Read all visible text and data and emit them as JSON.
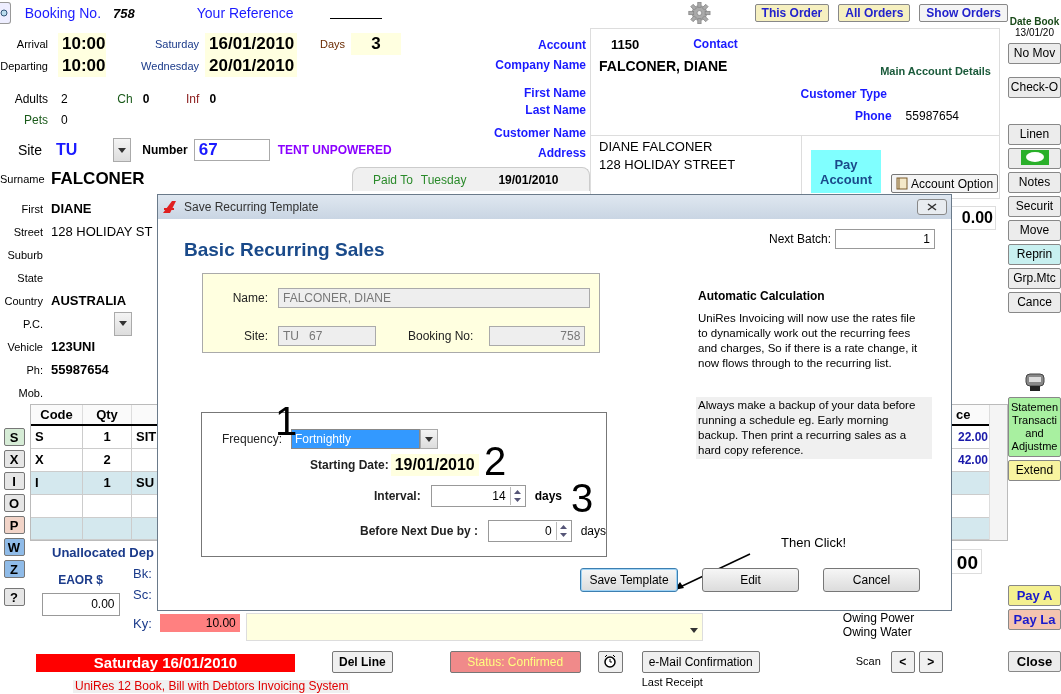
{
  "top_bar": {
    "booking_no_label": "Booking No.",
    "booking_no": "758",
    "reference_label": "Your Reference",
    "buttons": [
      "This Order",
      "All Orders",
      "Show Orders"
    ]
  },
  "stay": {
    "arrival_label": "Arrival",
    "arrival": "10:00",
    "departing_label": "Departing",
    "departing": "10:00",
    "arrival_day": "Saturday",
    "arrival_date": "16/01/2010",
    "departing_day": "Wednesday",
    "departing_date": "20/01/2010",
    "days_label": "Days",
    "days": "3"
  },
  "guests": [
    {
      "label": "Adults",
      "value": "2"
    },
    {
      "label": "Ch",
      "value": "0"
    },
    {
      "label": "Inf",
      "value": "0"
    },
    {
      "label": "Pets",
      "value": "0"
    }
  ],
  "site": {
    "label": "Site",
    "code": "TU",
    "number_label": "Number",
    "number": "67",
    "type": "TENT UNPOWERED"
  },
  "account_labels": [
    "Account",
    "Company Name",
    "First Name",
    "Last Name",
    "Customer Name",
    "Address"
  ],
  "paid_to": {
    "label": "Paid To",
    "day": "Tuesday",
    "date": "19/01/2010"
  },
  "customer": [
    {
      "kind": "name",
      "label": "Surname",
      "value": "FALCONER"
    },
    {
      "kind": "text",
      "label": "First",
      "value": "DIANE"
    },
    {
      "kind": "text",
      "label": "Street",
      "value": "128 HOLIDAY ST"
    },
    {
      "kind": "text",
      "label": "Suburb"
    },
    {
      "kind": "text",
      "label": "State"
    },
    {
      "kind": "text",
      "label": "Country",
      "value": "AUSTRALIA"
    },
    {
      "kind": "select",
      "label": "P.C."
    },
    {
      "kind": "text",
      "label": "Vehicle",
      "value": "123UNI"
    },
    {
      "kind": "text",
      "label": "Ph:",
      "value": "55987654"
    },
    {
      "kind": "text",
      "label": "Mob."
    }
  ],
  "account": {
    "number": "1150",
    "contact_label": "Contact",
    "name": "FALCONER, DIANE",
    "details_title": "Main Account Details",
    "type_label": "Customer Type",
    "phone_label": "Phone",
    "phone": "55987654",
    "customer_name": "DIANE FALCONER",
    "address": "128 HOLIDAY STREET",
    "pay_button": "Pay Account",
    "option_button": "Account Option",
    "balance": "0.00"
  },
  "letter_buttons": [
    {
      "label": "S",
      "color": "#d6ecd6"
    },
    {
      "label": "X",
      "color": "#e6e6e6"
    },
    {
      "label": "I",
      "color": "#e6e6e6"
    },
    {
      "label": "O",
      "color": "#e6e6e6"
    },
    {
      "label": "P",
      "color": "#f2d4c8"
    },
    {
      "label": "W",
      "color": "#8fbbe8"
    },
    {
      "label": "Z",
      "color": "#8fbbe8"
    },
    {
      "label": "?",
      "color": "#e6e6e6"
    }
  ],
  "table": {
    "columns": [
      "Code",
      "Qty",
      "ce"
    ],
    "rows": [
      {
        "code": "S",
        "qty": "1",
        "description": "SIT",
        "price": "22.00",
        "shaded": false
      },
      {
        "code": "X",
        "qty": "2",
        "price": "42.00",
        "shaded": false
      },
      {
        "code": "I",
        "qty": "1",
        "description": "SU",
        "shaded": true
      },
      {
        "shaded": false
      },
      {
        "shaded": true
      }
    ]
  },
  "deposit": {
    "title": "Unallocated Dep",
    "eaor_label": "EAOR $",
    "eaor": "0.00",
    "bk_label": "Bk:",
    "sc_label": "Sc:",
    "ky_label": "Ky:",
    "ky_value": "10.00"
  },
  "total_fragment": "00",
  "owing": [
    "Owing Power",
    "Owing Water"
  ],
  "bottom": {
    "date_banner": "Saturday 16/01/2010",
    "app_name": "UniRes 12 Book, Bill with Debtors Invoicing System",
    "del_line": "Del Line",
    "status": "Status: Confirmed",
    "email": "e-Mail Confirmation",
    "last_receipt": "Last Receipt",
    "scan_label": "Scan",
    "scan_buttons": [
      "<",
      ">"
    ]
  },
  "right_column": {
    "booked_label": "Date Book",
    "booked_date": "13/01/20",
    "groups": [
      [
        {
          "kind": "button",
          "label": "No Mov",
          "color": "#ececec"
        }
      ],
      [
        {
          "kind": "button",
          "label": "Check-O",
          "color": "#ececec"
        }
      ],
      [
        {
          "kind": "button",
          "label": "Linen",
          "color": "#ececec"
        },
        {
          "kind": "sms",
          "color": "#ececec"
        },
        {
          "kind": "button",
          "label": "Notes",
          "color": "#ececec"
        },
        {
          "kind": "button",
          "label": "Securit",
          "color": "#ececec"
        },
        {
          "kind": "button",
          "label": "Move",
          "color": "#ececec"
        },
        {
          "kind": "button",
          "label": "Reprin",
          "color": "#c8f0f0"
        },
        {
          "kind": "button",
          "label": "Grp.Mtc",
          "color": "#ececec"
        },
        {
          "kind": "button",
          "label": "Cance",
          "color": "#ececec"
        }
      ],
      [
        {
          "kind": "printer"
        },
        {
          "kind": "block",
          "label": "Statemen Transacti and Adjustme",
          "color": "#a8f0a0"
        },
        {
          "kind": "button",
          "label": "Extend",
          "color": "#f8f4a0"
        }
      ],
      [
        {
          "kind": "bold",
          "label": "Pay A",
          "color": "#f4f090"
        },
        {
          "kind": "bold",
          "label": "Pay La",
          "color": "#f4c4b0"
        }
      ],
      [
        {
          "kind": "bold",
          "label": "Close",
          "color": "#ececec"
        }
      ]
    ]
  },
  "dialog": {
    "title": "Save Recurring Template",
    "heading": "Basic Recurring Sales",
    "next_batch_label": "Next Batch:",
    "next_batch": "1",
    "name_label": "Name:",
    "name": "FALCONER, DIANE",
    "site_label": "Site:",
    "site": "TU   67",
    "booking_label": "Booking No:",
    "booking": "758",
    "info_title": "Automatic Calculation",
    "info_text": "UniRes Invoicing will now use the rates file to dynamically work out the recurring fees and charges, So if there is a rate change, it now flows through to the recurring list.",
    "backup_note": "Always make a backup of your data before running a schedule eg. Early morning backup. Then print a recurring sales as a hard copy reference.",
    "frequency_label": "Frequency:",
    "frequency": "Fortnightly",
    "start_label": "Starting Date:",
    "start_date": "19/01/2010",
    "interval_label": "Interval:",
    "interval": "14",
    "interval_unit": "days",
    "before_label": "Before Next Due by :",
    "before": "0",
    "before_unit": "days",
    "buttons": [
      {
        "label": "Save Template",
        "focused": true
      },
      {
        "label": "Edit",
        "focused": false
      },
      {
        "label": "Cancel",
        "focused": false
      }
    ],
    "annotations": [
      "1",
      "2",
      "3"
    ],
    "callout": "Then Click!"
  }
}
